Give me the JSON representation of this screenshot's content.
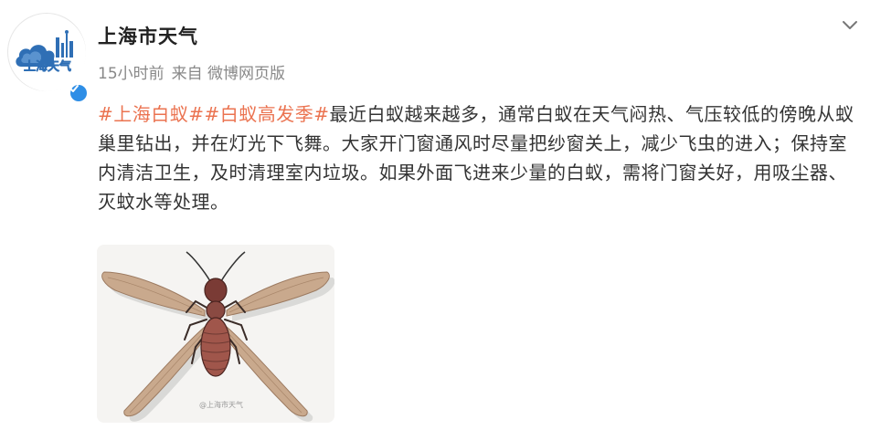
{
  "post": {
    "account_name": "上海市天气",
    "avatar_text": "上海天气",
    "time": "15小时前",
    "source": "来自 微博网页版",
    "hashtags": [
      "#上海白蚁#",
      "#白蚁高发季#"
    ],
    "body": "最近白蚁越来越多，通常白蚁在天气闷热、气压较低的傍晚从蚁巢里钻出，并在灯光下飞舞。大家开门窗通风时尽量把纱窗关上，减少飞虫的进入；保持室内清洁卫生，及时清理室内垃圾。如果外面飞进来少量的白蚁，需将门窗关好，用吸尘器、灭蚊水等处理。",
    "image_watermark": "@上海市天气"
  },
  "colors": {
    "hashtag": "#eb7350",
    "verified": "#2e8ee6",
    "avatar_blue": "#2f6fb5"
  },
  "icons": {
    "menu": "chevron-down-icon",
    "verified": "verified-badge-icon"
  }
}
